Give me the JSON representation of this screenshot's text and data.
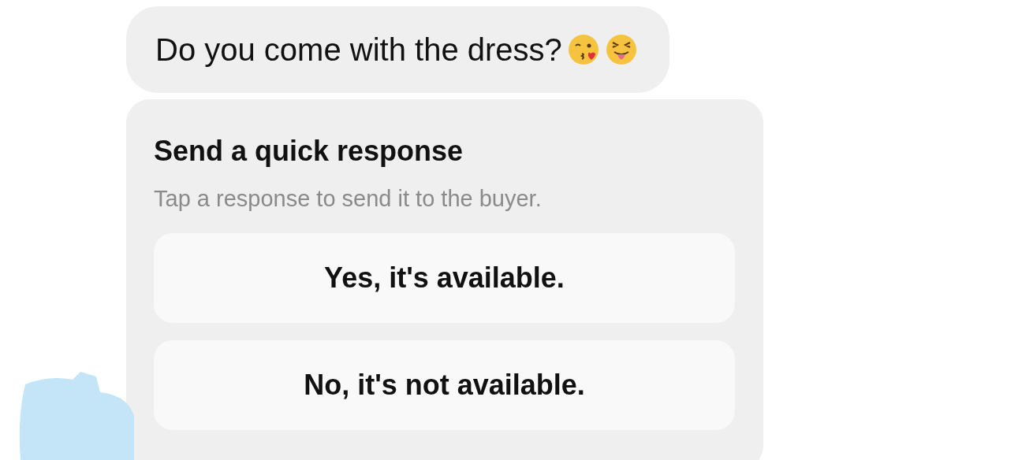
{
  "message": {
    "text": "Do you come with the dress?"
  },
  "quick_response": {
    "title": "Send a quick response",
    "subtitle": "Tap a response to send it to the buyer.",
    "responses": [
      {
        "label": "Yes, it's available."
      },
      {
        "label": "No, it's not available."
      }
    ]
  }
}
